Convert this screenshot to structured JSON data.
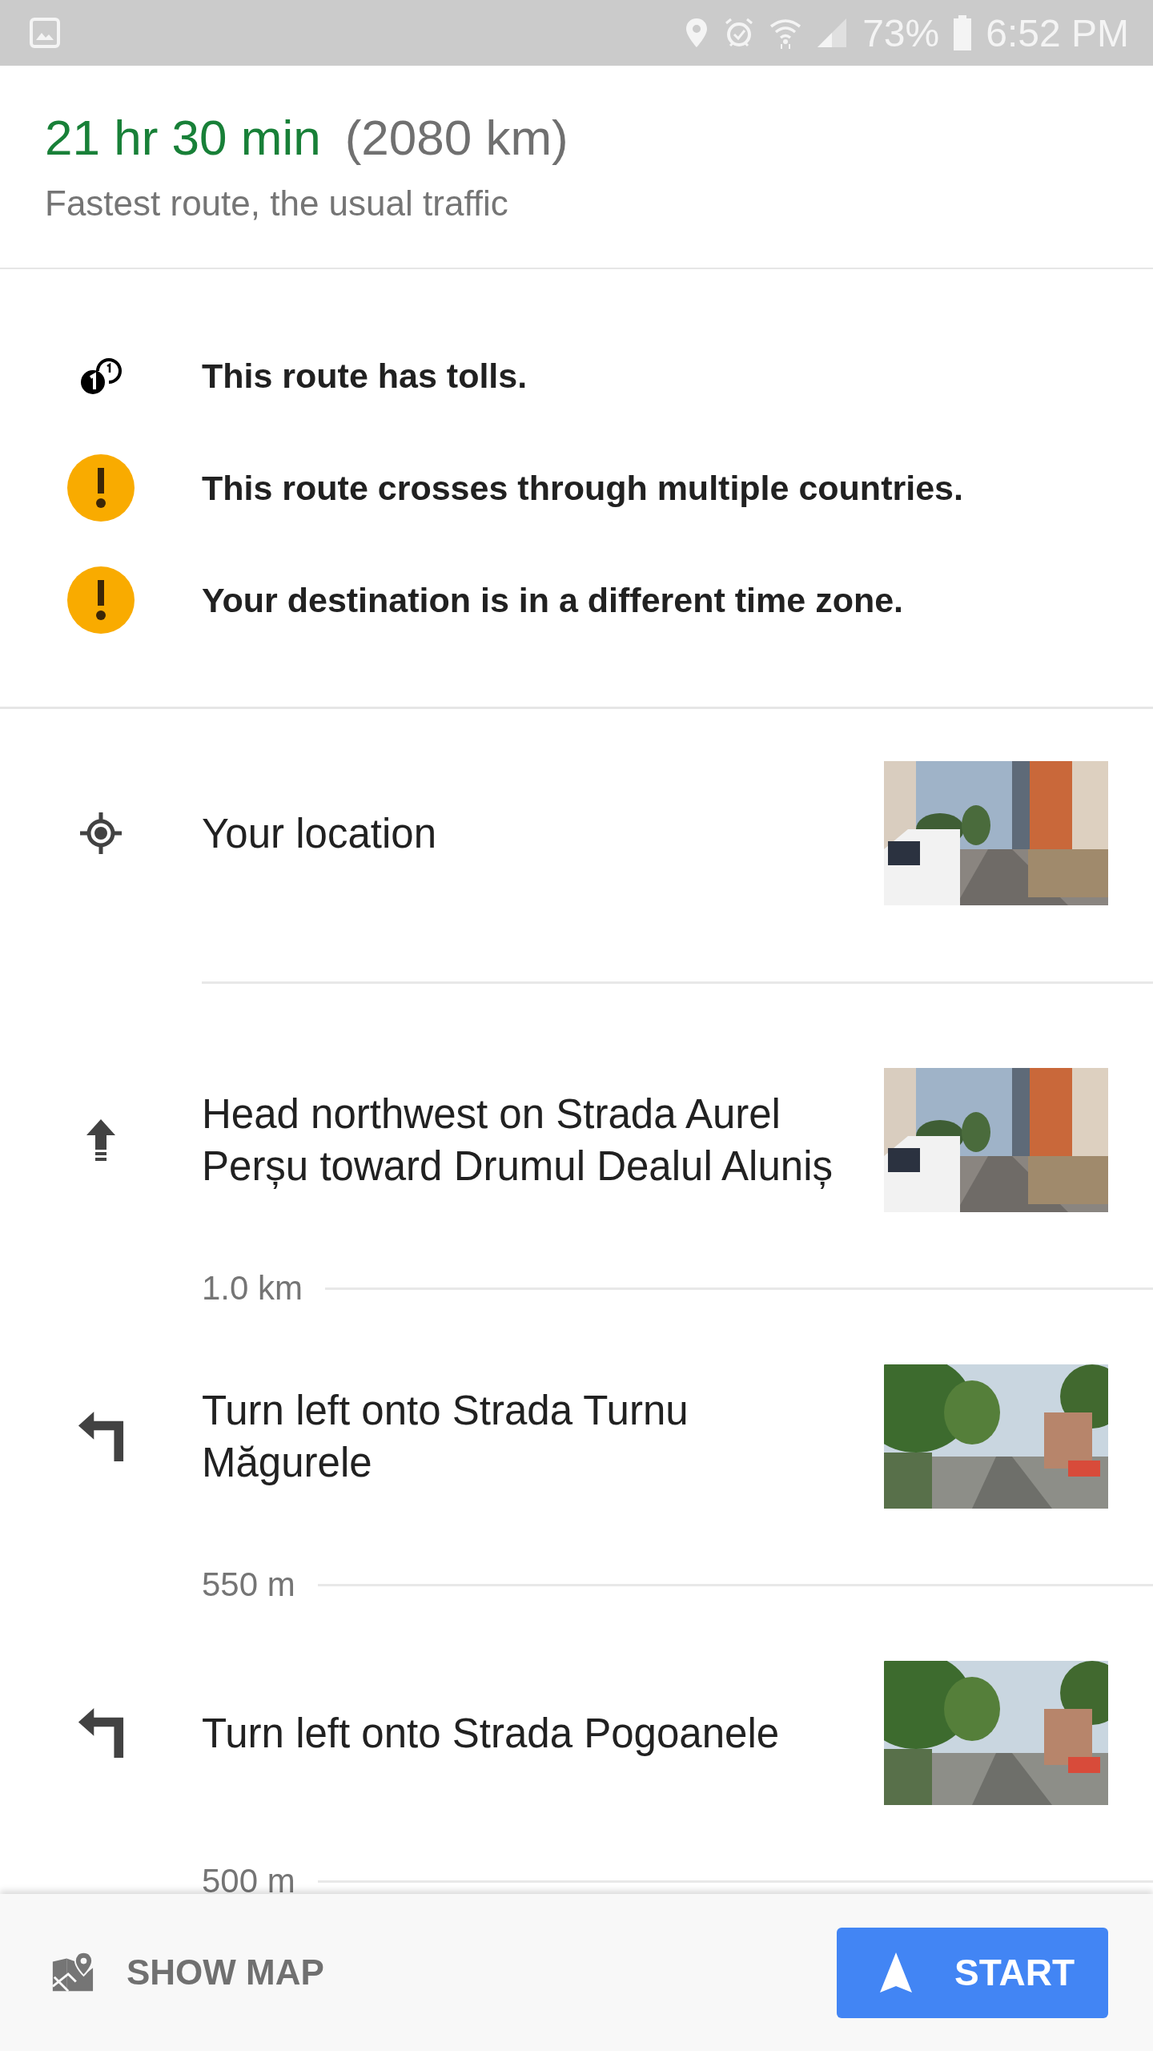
{
  "status_bar": {
    "battery": "73%",
    "time": "6:52 PM"
  },
  "route": {
    "duration": "21 hr 30 min",
    "distance": "(2080 km)",
    "description": "Fastest route, the usual traffic"
  },
  "notices": [
    {
      "kind": "toll",
      "text": "This route has tolls."
    },
    {
      "kind": "warning",
      "text": "This route crosses through multiple countries."
    },
    {
      "kind": "warning",
      "text": "Your destination is in a different time zone."
    }
  ],
  "steps": [
    {
      "kind": "origin",
      "text": "Your location"
    },
    {
      "kind": "straight",
      "text": "Head northwest on Strada Aurel Perșu toward Drumul Dealul Aluniș",
      "distance": "1.0 km"
    },
    {
      "kind": "left",
      "text": "Turn left onto Strada Turnu Măgurele",
      "distance": "550 m"
    },
    {
      "kind": "left",
      "text": "Turn left onto Strada Pogoanele",
      "distance": "500 m"
    }
  ],
  "buttons": {
    "show_map": "SHOW MAP",
    "start": "START"
  }
}
